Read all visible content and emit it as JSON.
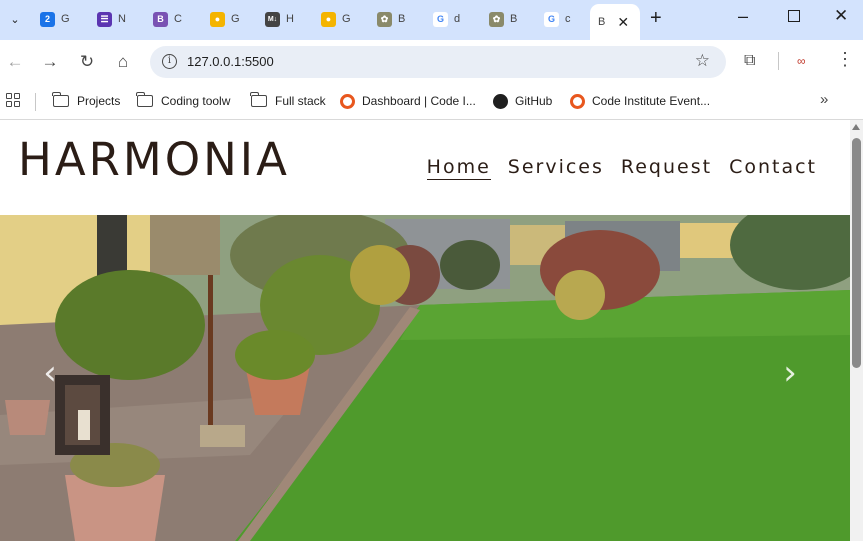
{
  "browser": {
    "tabs": [
      {
        "label": "G",
        "favicon": "calendar-icon",
        "color": "#1a73e8",
        "glyph": "2"
      },
      {
        "label": "N",
        "favicon": "list-icon",
        "color": "#5b35b1",
        "glyph": "☰"
      },
      {
        "label": "C",
        "favicon": "bootstrap-icon",
        "color": "#7952b3",
        "glyph": "B"
      },
      {
        "label": "G",
        "favicon": "keep-icon",
        "color": "#f4b400",
        "glyph": "◉"
      },
      {
        "label": "H",
        "favicon": "markdown-icon",
        "color": "#444444",
        "glyph": "M↓"
      },
      {
        "label": "G",
        "favicon": "keep-icon",
        "color": "#f4b400",
        "glyph": "◉"
      },
      {
        "label": "B",
        "favicon": "plant-icon",
        "color": "#8a8a6a",
        "glyph": "✿"
      },
      {
        "label": "d",
        "favicon": "google-icon",
        "color": "#ffffff",
        "glyph": "G"
      },
      {
        "label": "B",
        "favicon": "plant-icon",
        "color": "#8a8a6a",
        "glyph": "✿"
      },
      {
        "label": "c",
        "favicon": "google-icon",
        "color": "#ffffff",
        "glyph": "G"
      }
    ],
    "active_tab": {
      "label": "B"
    },
    "url": "127.0.0.1:5500",
    "bookmarks": [
      {
        "label": "Projects",
        "icon": "folder-icon"
      },
      {
        "label": "Coding toolw",
        "icon": "folder-icon"
      },
      {
        "label": "Full stack",
        "icon": "folder-icon"
      },
      {
        "label": "Dashboard | Code I...",
        "icon": "code-institute-icon"
      },
      {
        "label": "GitHub",
        "icon": "github-icon"
      },
      {
        "label": "Code Institute Event...",
        "icon": "code-institute-icon"
      }
    ]
  },
  "site": {
    "brand": "HARMONIA",
    "nav": [
      {
        "label": "Home",
        "current": true
      },
      {
        "label": "Services",
        "current": false
      },
      {
        "label": "Request",
        "current": false
      },
      {
        "label": "Contact",
        "current": false
      }
    ],
    "carousel": {
      "prev_label": "‹",
      "next_label": "›"
    }
  }
}
